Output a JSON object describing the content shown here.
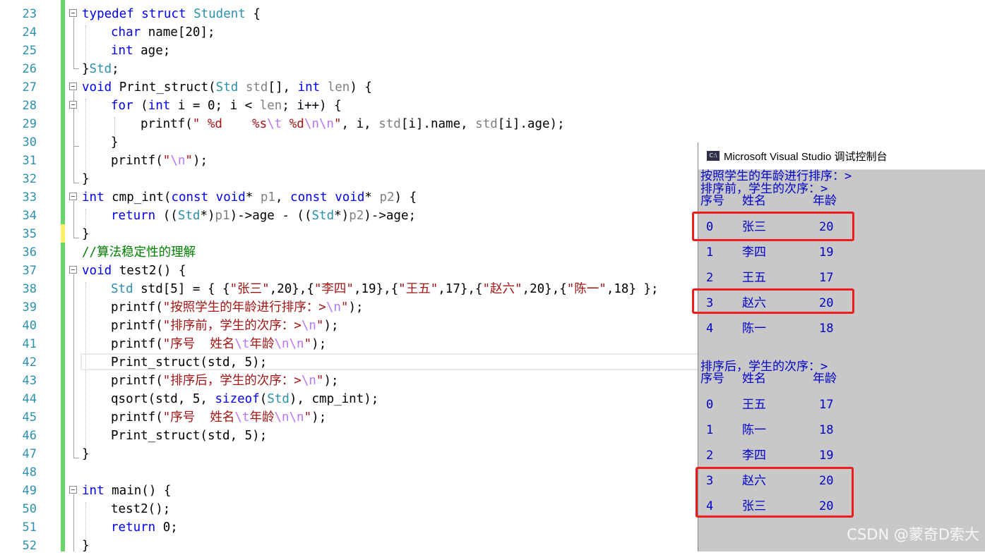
{
  "editor": {
    "line_numbers": [
      "23",
      "24",
      "25",
      "26",
      "27",
      "28",
      "29",
      "30",
      "31",
      "32",
      "33",
      "34",
      "35",
      "36",
      "37",
      "38",
      "39",
      "40",
      "41",
      "42",
      "43",
      "44",
      "45",
      "46",
      "47",
      "48",
      "49",
      "50",
      "51",
      "52"
    ],
    "lines": {
      "l23a": "typedef struct",
      "l23b": "Student",
      "l23c": " {",
      "l24a": "char",
      "l24b": " name[20];",
      "l25a": "int",
      "l25b": " age;",
      "l26a": "}",
      "l26b": "Std",
      "l26c": ";",
      "l27a": "void",
      "l27b": " Print_struct(",
      "l27c": "Std",
      "l27d": " std",
      "l27e": "[], ",
      "l27f": "int",
      "l27g": " len",
      "l27h": ") {",
      "l28a": "for",
      "l28b": " (",
      "l28c": "int",
      "l28d": " i = 0; i < ",
      "l28e": "len",
      "l28f": "; i++) {",
      "l29a": "printf(",
      "l29b": "\" %d    %s",
      "l29c": "\\t",
      "l29d": " %d",
      "l29e": "\\n\\n",
      "l29f": "\"",
      "l29g": ", i, ",
      "l29h": "std",
      "l29i": "[i].name, ",
      "l29j": "std",
      "l29k": "[i].age);",
      "l30a": "}",
      "l31a": "printf(",
      "l31b": "\"",
      "l31c": "\\n",
      "l31d": "\"",
      "l31e": ");",
      "l32a": "}",
      "l33a": "int",
      "l33b": " cmp_int(",
      "l33c": "const void",
      "l33d": "* ",
      "l33e": "p1",
      "l33f": ", ",
      "l33g": "const void",
      "l33h": "* ",
      "l33i": "p2",
      "l33j": ") {",
      "l34a": "return",
      "l34b": " ((",
      "l34c": "Std",
      "l34d": "*)",
      "l34e": "p1",
      "l34f": ")->age - ((",
      "l34g": "Std",
      "l34h": "*)",
      "l34i": "p2",
      "l34j": ")->age;",
      "l35a": "}",
      "l36a": "//算法稳定性的理解",
      "l37a": "void",
      "l37b": " test2() {",
      "l38a": "Std",
      "l38b": " std[5] = { {",
      "l38c": "\"张三\"",
      "l38d": ",20},{",
      "l38e": "\"李四\"",
      "l38f": ",19},{",
      "l38g": "\"王五\"",
      "l38h": ",17},{",
      "l38i": "\"赵六\"",
      "l38j": ",20},{",
      "l38k": "\"陈一\"",
      "l38l": ",18} };",
      "l39a": "printf(",
      "l39b": "\"按照学生的年龄进行排序：>",
      "l39c": "\\n",
      "l39d": "\"",
      "l39e": ");",
      "l40a": "printf(",
      "l40b": "\"排序前，学生的次序：>",
      "l40c": "\\n",
      "l40d": "\"",
      "l40e": ");",
      "l41a": "printf(",
      "l41b": "\"序号  姓名",
      "l41c": "\\t",
      "l41d": "年龄",
      "l41e": "\\n\\n",
      "l41f": "\"",
      "l41g": ");",
      "l42a": "Print_struct(std, 5);",
      "l43a": "printf(",
      "l43b": "\"排序后，学生的次序：>",
      "l43c": "\\n",
      "l43d": "\"",
      "l43e": ");",
      "l44a": "qsort(std, 5, ",
      "l44b": "sizeof",
      "l44c": "(",
      "l44d": "Std",
      "l44e": "), cmp_int);",
      "l45a": "printf(",
      "l45b": "\"序号  姓名",
      "l45c": "\\t",
      "l45d": "年龄",
      "l45e": "\\n\\n",
      "l45f": "\"",
      "l45g": ");",
      "l46a": "Print_struct(std, 5);",
      "l47a": "}",
      "l49a": "int",
      "l49b": " main() {",
      "l50a": "test2();",
      "l51a": "return",
      "l51b": " 0;",
      "l52a": "}"
    }
  },
  "console": {
    "title": "Microsoft Visual Studio 调试控制台",
    "icon_label": "C:\\",
    "heading1": "按照学生的年龄进行排序：>",
    "heading2": "排序前，学生的次序：>",
    "heading3": "排序后，学生的次序：>",
    "col_no": "序号",
    "col_name": "姓名",
    "col_age": "年龄",
    "before": [
      {
        "no": "0",
        "name": "张三",
        "age": "20"
      },
      {
        "no": "1",
        "name": "李四",
        "age": "19"
      },
      {
        "no": "2",
        "name": "王五",
        "age": "17"
      },
      {
        "no": "3",
        "name": "赵六",
        "age": "20"
      },
      {
        "no": "4",
        "name": "陈一",
        "age": "18"
      }
    ],
    "after": [
      {
        "no": "0",
        "name": "王五",
        "age": "17"
      },
      {
        "no": "1",
        "name": "陈一",
        "age": "18"
      },
      {
        "no": "2",
        "name": "李四",
        "age": "19"
      },
      {
        "no": "3",
        "name": "赵六",
        "age": "20"
      },
      {
        "no": "4",
        "name": "张三",
        "age": "20"
      }
    ],
    "highlight_color": "#ee1c1c",
    "text_color": "#0000c8"
  },
  "watermark": "CSDN @蒙奇D索大",
  "colors": {
    "keyword": "#0000ff",
    "type": "#2b91af",
    "string": "#a31515",
    "escape": "#b776fb",
    "comment": "#008000",
    "line_number": "#2b91af",
    "change_bar": "#6ad56a"
  }
}
